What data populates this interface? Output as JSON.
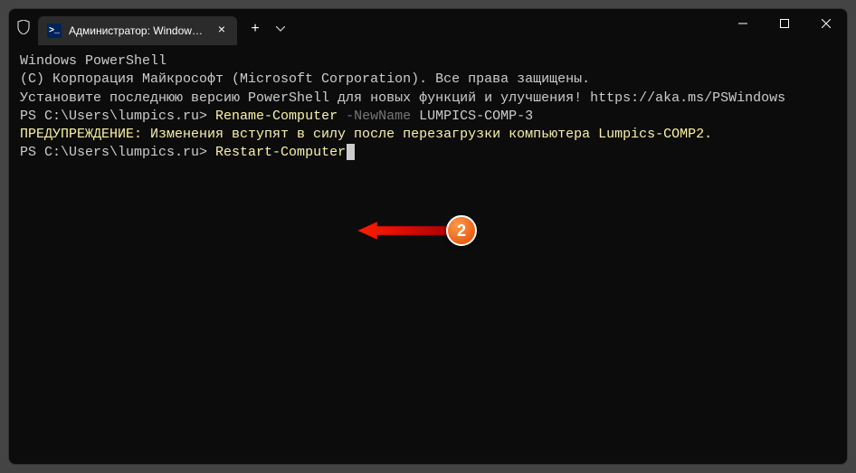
{
  "tab": {
    "title": "Администратор: Windows Po",
    "icon_label": ">_"
  },
  "terminal": {
    "line1": "Windows PowerShell",
    "line2": "(C) Корпорация Майкрософт (Microsoft Corporation). Все права защищены.",
    "line3": "",
    "line4": "Установите последнюю версию PowerShell для новых функций и улучшения! https://aka.ms/PSWindows",
    "line5": "",
    "prompt1_path": "PS C:\\Users\\lumpics.ru> ",
    "cmd1": "Rename-Computer",
    "param1": " -NewName",
    "arg1": " LUMPICS-COMP-3",
    "warning": "ПРЕДУПРЕЖДЕНИЕ: Изменения вступят в силу после перезагрузки компьютера Lumpics-COMP2.",
    "prompt2_path": "PS C:\\Users\\lumpics.ru> ",
    "cmd2": "Restart-Computer"
  },
  "annotation": {
    "number": "2"
  }
}
